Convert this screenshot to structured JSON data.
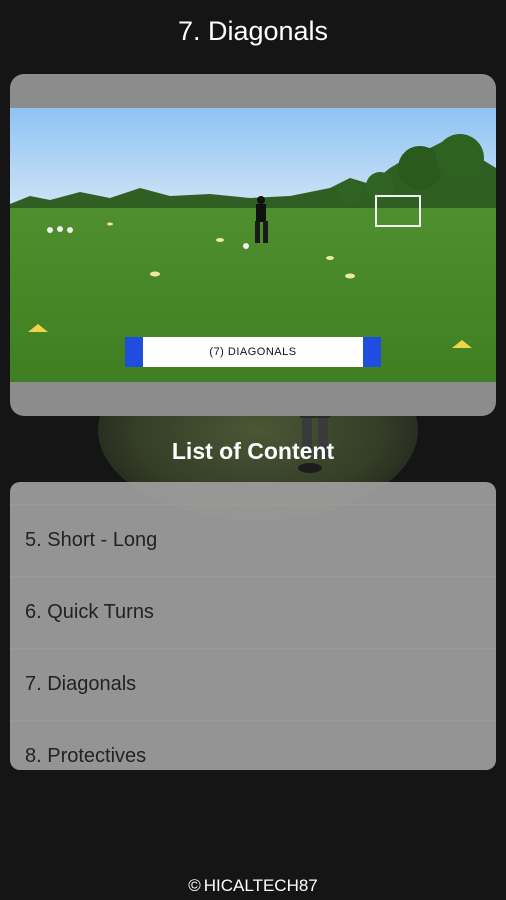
{
  "header": {
    "title": "7. Diagonals"
  },
  "video": {
    "caption": "(7) DIAGONALS"
  },
  "content": {
    "heading": "List of Content",
    "items": [
      {
        "label": "5. Short - Long"
      },
      {
        "label": "6. Quick Turns"
      },
      {
        "label": "7. Diagonals"
      },
      {
        "label": "8. Protectives"
      }
    ]
  },
  "footer": {
    "text": "HICALTECH87",
    "symbol": "©"
  },
  "colors": {
    "accent_blue": "#1f4de0",
    "background": "#151515"
  }
}
